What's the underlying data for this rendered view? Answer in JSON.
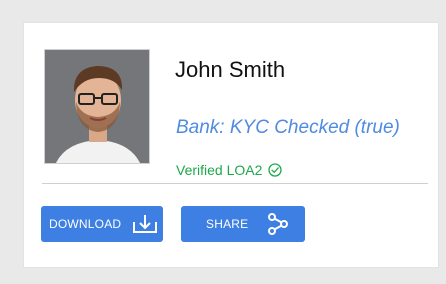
{
  "profile": {
    "name": "John Smith",
    "bank_status": "Bank: KYC Checked (true)",
    "verified_label": "Verified LOA2"
  },
  "actions": {
    "download_label": "DOWNLOAD",
    "share_label": "SHARE"
  },
  "icons": {
    "download": "download-icon",
    "share": "share-icon",
    "verified": "check-circle-icon"
  },
  "colors": {
    "background": "#e9e9ea",
    "card": "#ffffff",
    "button": "#3e7fe3",
    "bank_text": "#4f8be0",
    "verified_text": "#1ea84a"
  }
}
